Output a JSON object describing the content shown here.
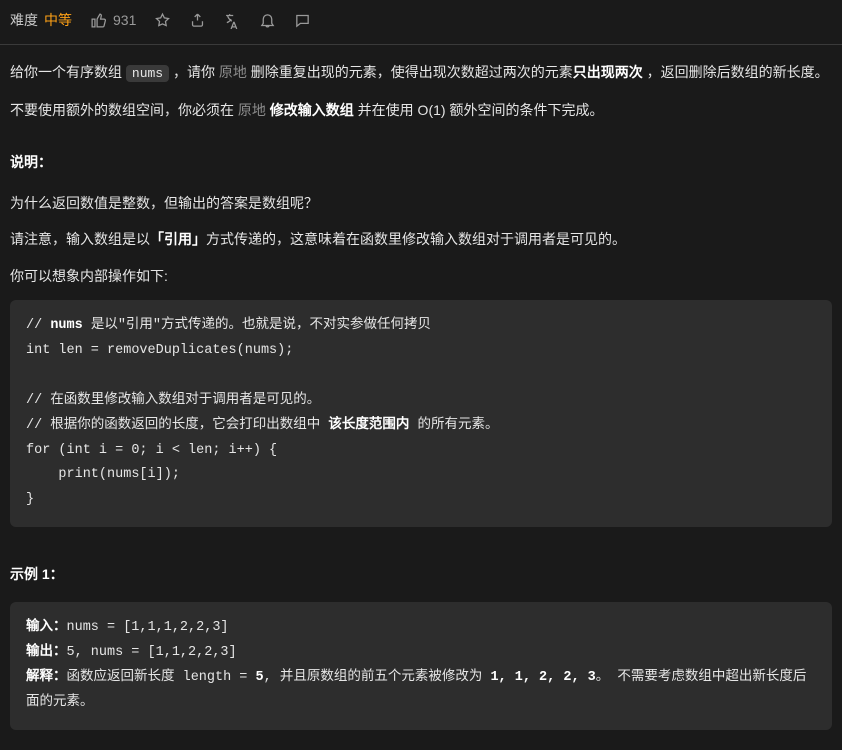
{
  "toolbar": {
    "difficulty_label": "难度",
    "difficulty_value": "中等",
    "likes": "931"
  },
  "problem": {
    "p1_prefix": "给你一个有序数组 ",
    "p1_code": "nums",
    "p1_mid1": " ，请你 ",
    "p1_gray1": "原地",
    "p1_mid2": " 删除重复出现的元素，使得出现次数超过两次的元素",
    "p1_bold1": "只出现两次",
    "p1_suffix": " ，返回删除后数组的新长度。",
    "p2_prefix": "不要使用额外的数组空间，你必须在 ",
    "p2_gray1": "原地 ",
    "p2_bold1": "修改输入数组",
    "p2_suffix": " 并在使用 O(1) 额外空间的条件下完成。"
  },
  "explain": {
    "heading": "说明：",
    "q1": "为什么返回数值是整数，但输出的答案是数组呢？",
    "q2_prefix": "请注意，输入数组是以",
    "q2_bold": "「引用」",
    "q2_suffix": "方式传递的，这意味着在函数里修改输入数组对于调用者是可见的。",
    "q3": "你可以想象内部操作如下:"
  },
  "code1": {
    "c1": "// ",
    "c1b": "nums",
    "c1s": " 是以\"引用\"方式传递的。也就是说，不对实参做任何拷贝",
    "l2": "int len = removeDuplicates(nums);",
    "l4": "// 在函数里修改输入数组对于调用者是可见的。",
    "l5a": "// 根据你的函数返回的长度，它会打印出数组中 ",
    "l5b": "该长度范围内",
    "l5c": " 的所有元素。",
    "l6": "for (int i = 0; i < len; i++) {",
    "l7": "    print(nums[i]);",
    "l8": "}"
  },
  "example": {
    "heading": "示例 1：",
    "in_label": "输入：",
    "in_val": "nums = [1,1,1,2,2,3]",
    "out_label": "输出：",
    "out_val": "5, nums = [1,1,2,2,3]",
    "exp_label": "解释：",
    "exp_a": "函数应返回新长度 length = ",
    "exp_b": "5",
    "exp_c": ", 并且原数组的前五个元素被修改为 ",
    "exp_d": "1, 1, 2, 2, 3",
    "exp_e": "。 不需要考虑数组中超出新长度后面的元素。"
  }
}
